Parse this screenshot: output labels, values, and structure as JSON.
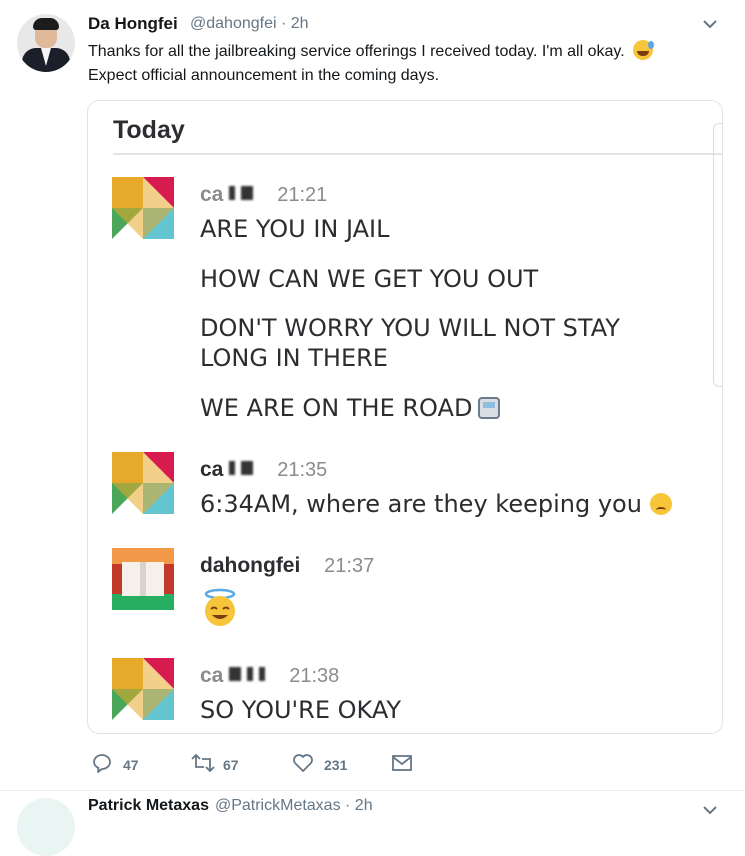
{
  "tweet": {
    "name": "Da Hongfei",
    "handle": "@dahongfei · 2h",
    "text_line1": "Thanks for all the jailbreaking service offerings I received today. I'm all okay.",
    "text_line2": "Expect official announcement in the coming days.",
    "emoji": "grinning-sweat-emoji"
  },
  "card": {
    "heading": "Today",
    "messages": [
      {
        "sender": "ca",
        "time": "21:21",
        "lines": [
          "ARE YOU IN JAIL",
          "HOW CAN WE GET YOU OUT",
          "DON'T WORRY YOU WILL NOT STAY",
          "LONG IN THERE",
          "WE ARE ON THE ROAD"
        ]
      },
      {
        "sender": "ca",
        "time": "21:35",
        "lines": [
          "6:34AM, where are they keeping you"
        ]
      },
      {
        "sender": "dahongfei",
        "time": "21:37",
        "lines": []
      },
      {
        "sender": "ca",
        "time": "21:38",
        "lines": [
          "SO YOU'RE OKAY"
        ]
      }
    ]
  },
  "actions": {
    "replies": "47",
    "retweets": "67",
    "likes": "231"
  },
  "next_tweet": {
    "name": "Patrick Metaxas",
    "handle": "@PatrickMetaxas · 2h"
  },
  "colors": {
    "link_grey": "#657786",
    "text": "#14171a",
    "slack_text": "#2c2d30"
  }
}
